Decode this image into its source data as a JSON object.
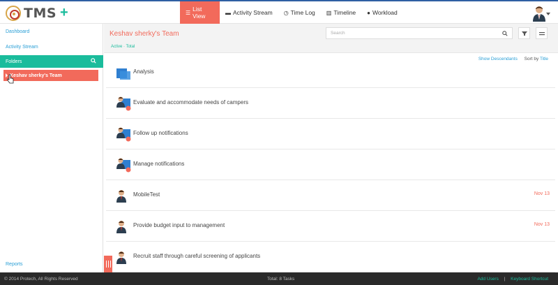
{
  "app": {
    "logo_text": "TMS",
    "add_label": "+"
  },
  "nav": [
    {
      "label": "List View",
      "icon": "list-icon",
      "active": true
    },
    {
      "label": "Activity Stream",
      "icon": "comment-icon",
      "active": false
    },
    {
      "label": "Time Log",
      "icon": "clock-icon",
      "active": false
    },
    {
      "label": "Timeline",
      "icon": "timeline-icon",
      "active": false
    },
    {
      "label": "Workload",
      "icon": "user-icon",
      "active": false
    }
  ],
  "sidebar": {
    "dashboard": "Dashboard",
    "activity_stream": "Activity Stream",
    "folders": "Folders",
    "team": "Keshav sherky's Team",
    "reports": "Reports"
  },
  "main": {
    "title": "Keshav sherky's Team",
    "filters": "Active · Total",
    "search_placeholder": "Search",
    "show_descendants": "Show Descendants",
    "sort_by_prefix": "Sort by",
    "sort_by_value": "Title"
  },
  "tasks": [
    {
      "title": "Analysis",
      "date": "",
      "icon": "folder-icon"
    },
    {
      "title": "Evaluate and accommodate needs of campers",
      "date": "",
      "icon": "user-task-icon"
    },
    {
      "title": "Follow up notifications",
      "date": "",
      "icon": "user-task-icon"
    },
    {
      "title": "Manage notifications",
      "date": "",
      "icon": "user-task-icon"
    },
    {
      "title": "MobileTest",
      "date": "Nov 13",
      "icon": "user-icon"
    },
    {
      "title": "Provide budget input to management",
      "date": "Nov 13",
      "icon": "user-icon"
    },
    {
      "title": "Recruit staff through careful screening of applicants",
      "date": "",
      "icon": "user-icon"
    }
  ],
  "footer": {
    "copyright": "© 2014 Protech, All Rights Reserved",
    "total": "Total: 8 Tasks",
    "add_users": "Add Users",
    "separator": "|",
    "keyboard_shortcut": "Keyboard Shortcut"
  },
  "colors": {
    "accent": "#f26a5b",
    "teal": "#1abc9c",
    "link": "#2a9fd6",
    "footer": "#2a2a2a"
  }
}
